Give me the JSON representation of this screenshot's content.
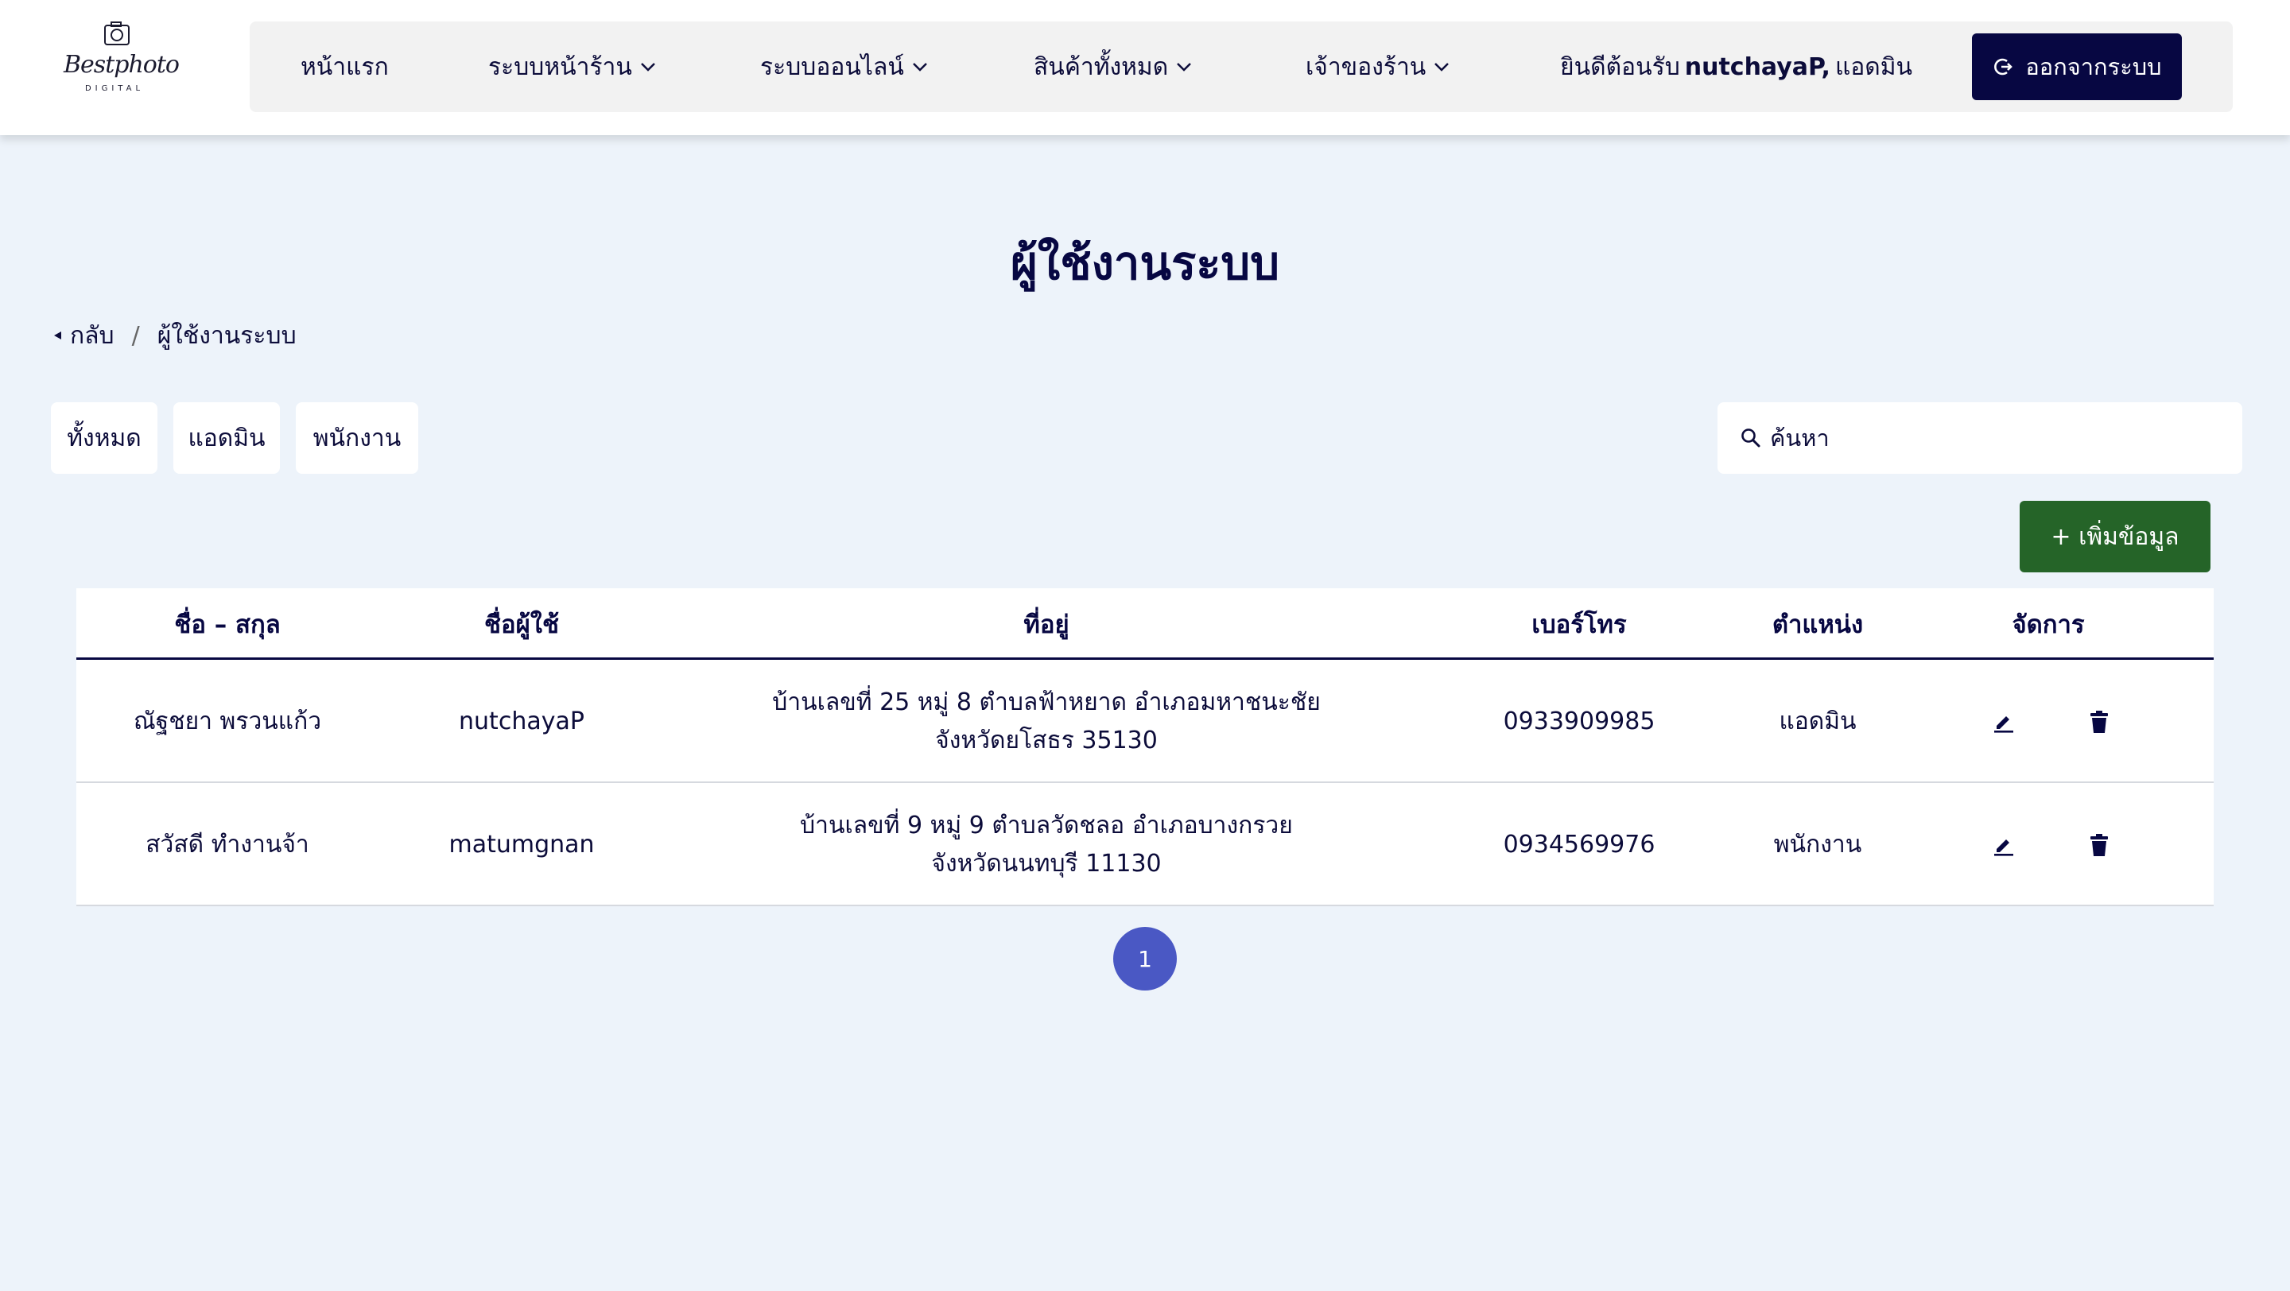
{
  "brand": {
    "logo_script": "Bestphoto",
    "logo_sub": "DIGITAL"
  },
  "nav": {
    "home": "หน้าแรก",
    "storefront": "ระบบหน้าร้าน",
    "online": "ระบบออนไลน์",
    "products": "สินค้าทั้งหมด",
    "owner": "เจ้าของร้าน",
    "welcome_prefix": "ยินดีต้อนรับ",
    "welcome_user": "nutchayaP,",
    "welcome_role": "แอดมิน",
    "logout": "ออกจากระบบ"
  },
  "page": {
    "title": "ผู้ใช้งานระบบ"
  },
  "breadcrumb": {
    "back": "กลับ",
    "separator": "/",
    "current": "ผู้ใช้งานระบบ"
  },
  "filters": {
    "all": "ทั้งหมด",
    "admin": "แอดมิน",
    "staff": "พนักงาน"
  },
  "search": {
    "placeholder": "ค้นหา"
  },
  "actions": {
    "add": "+ เพิ่มข้อมูล"
  },
  "table": {
    "headers": {
      "name": "ชื่อ – สกุล",
      "username": "ชื่อผู้ใช้",
      "address": "ที่อยู่",
      "phone": "เบอร์โทร",
      "position": "ตำแหน่ง",
      "manage": "จัดการ"
    },
    "rows": [
      {
        "name": "ณัฐชยา พรวนแก้ว",
        "username": "nutchayaP",
        "address_line1": "บ้านเลขที่ 25 หมู่ 8 ตำบลฟ้าหยาด อำเภอมหาชนะชัย",
        "address_line2": "จังหวัดยโสธร 35130",
        "phone": "0933909985",
        "position": "แอดมิน"
      },
      {
        "name": "สวัสดี ทำงานจ้า",
        "username": "matumgnan",
        "address_line1": "บ้านเลขที่ 9 หมู่ 9 ตำบลวัดชลอ อำเภอบางกรวย",
        "address_line2": "จังหวัดนนทบุรี 11130",
        "phone": "0934569976",
        "position": "พนักงาน"
      }
    ]
  },
  "pagination": {
    "current": "1"
  },
  "colors": {
    "navy": "#070742",
    "add_green": "#256428",
    "page_blue": "#4a58c4",
    "background": "#edf3fa"
  }
}
